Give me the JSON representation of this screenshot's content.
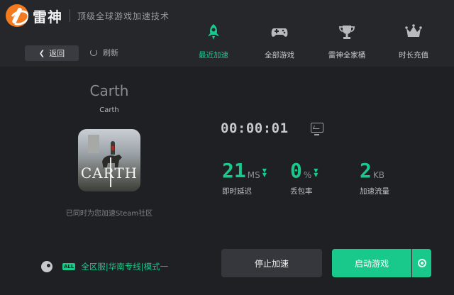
{
  "app": {
    "name": "雷神",
    "slogan": "顶级全球游戏加速技术"
  },
  "toolbar": {
    "back_label": "返回",
    "refresh_label": "刷新"
  },
  "nav": [
    {
      "label": "最近加速",
      "icon": "rocket-icon",
      "active": true
    },
    {
      "label": "全部游戏",
      "icon": "gamepad-icon",
      "active": false
    },
    {
      "label": "雷神全家桶",
      "icon": "trophy-icon",
      "active": false
    },
    {
      "label": "时长充值",
      "icon": "crown-icon",
      "active": false
    }
  ],
  "game": {
    "title": "Carth",
    "subtitle": "Carth",
    "cover_text": "CARTH",
    "steam_note": "已同时为您加速Steam社区"
  },
  "session": {
    "timer": "00:00:01"
  },
  "stats": [
    {
      "value": "21",
      "unit": "MS",
      "label": "即时延迟",
      "arrows": true
    },
    {
      "value": "0",
      "unit": "%",
      "label": "丢包率",
      "arrows": true
    },
    {
      "value": "2",
      "unit": "KB",
      "label": "加速流量",
      "arrows": false
    }
  ],
  "route": {
    "badge": "ALL",
    "text": "全区服|华南专线|模式一"
  },
  "actions": {
    "stop_label": "停止加速",
    "start_label": "启动游戏"
  },
  "colors": {
    "accent": "#18c98b",
    "brand": "#f47a1f",
    "background": "#1f2023",
    "header": "#26272b"
  }
}
